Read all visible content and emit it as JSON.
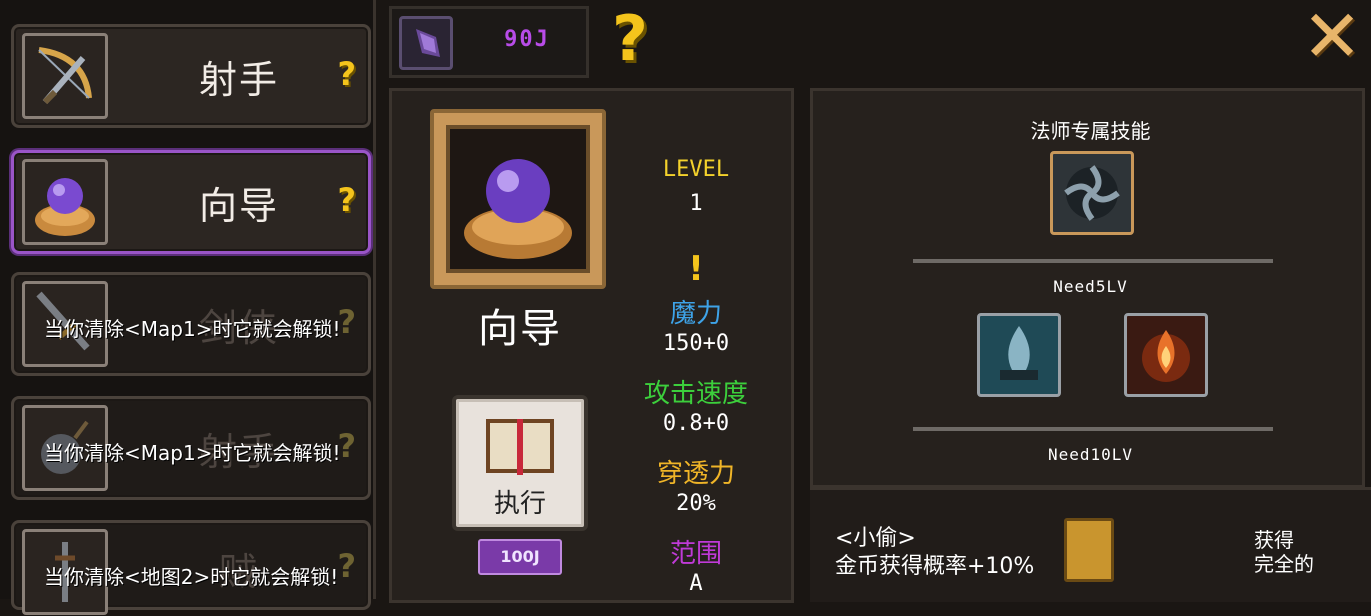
{
  "currency": {
    "value": "90J",
    "icon": "gem-icon",
    "color": "#b84ce8"
  },
  "help_icon": "question-mark-icon",
  "close_icon": "close-icon",
  "classes": [
    {
      "name": "射手",
      "icon": "crossbow-icon",
      "locked": false,
      "selected": false,
      "lock_text": ""
    },
    {
      "name": "向导",
      "icon": "orb-icon",
      "locked": false,
      "selected": true,
      "lock_text": ""
    },
    {
      "name": "剑侠",
      "icon": "sword-icon",
      "locked": true,
      "selected": false,
      "lock_text": "当你清除<Map1>时它就会解锁!"
    },
    {
      "name": "射手",
      "icon": "bomb-icon",
      "locked": true,
      "selected": false,
      "lock_text": "当你清除<Map1>时它就会解锁!"
    },
    {
      "name": "贼",
      "icon": "dagger-icon",
      "locked": true,
      "selected": false,
      "lock_text": "当你清除<地图2>时它就会解锁!"
    }
  ],
  "detail": {
    "name": "向导",
    "level_label": "LEVEL",
    "level_value": "1",
    "alert": "!",
    "stats": [
      {
        "label": "魔力",
        "value": "150+0",
        "color": "#3ea3e8"
      },
      {
        "label": "攻击速度",
        "value": "0.8+0",
        "color": "#3ccf3c"
      },
      {
        "label": "穿透力",
        "value": "20%",
        "color": "#f0b528"
      },
      {
        "label": "范围",
        "value": "A",
        "color": "#c03ad8"
      }
    ],
    "execute_label": "执行",
    "cost": "100J"
  },
  "skills": {
    "title": "法师专属技能",
    "tiers": [
      {
        "need": "Need5LV"
      },
      {
        "need": "Need10LV"
      }
    ]
  },
  "bonus": {
    "name": "<小偷>",
    "desc": "金币获得概率+10%",
    "obtain_line1": "获得",
    "obtain_line2": "完全的"
  }
}
